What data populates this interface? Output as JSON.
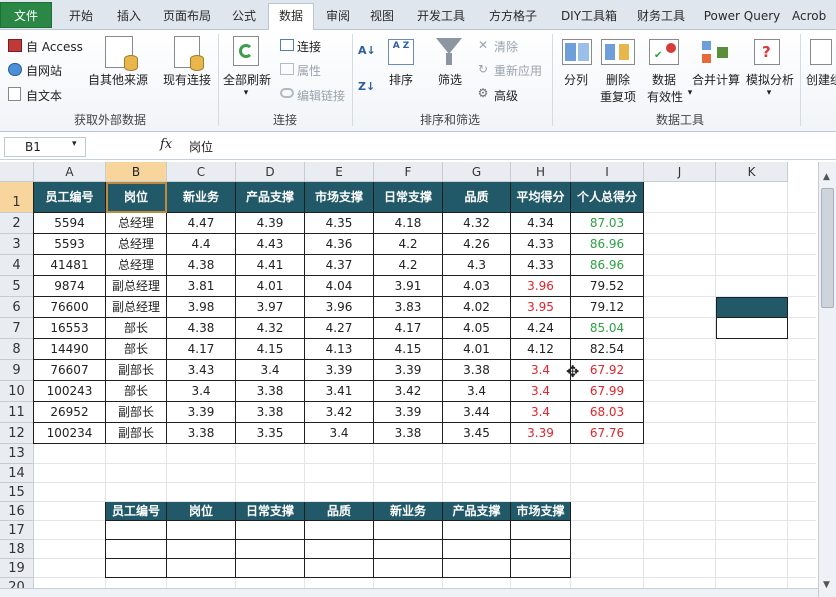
{
  "tabs": [
    "文件",
    "开始",
    "插入",
    "页面布局",
    "公式",
    "数据",
    "审阅",
    "视图",
    "开发工具",
    "方方格子",
    "DIY工具箱",
    "财务工具",
    "Power Query",
    "Acrob"
  ],
  "ribbon": {
    "get_external": {
      "access": "自 Access",
      "web": "自网站",
      "text": "自文本",
      "other": "自其他来源",
      "existing": "现有连接",
      "group": "获取外部数据"
    },
    "connections": {
      "refresh_all": "全部刷新",
      "connections": "连接",
      "properties": "属性",
      "edit_links": "编辑链接",
      "group": "连接"
    },
    "sort_filter": {
      "sort": "排序",
      "filter": "筛选",
      "clear": "清除",
      "reapply": "重新应用",
      "advanced": "高级",
      "group": "排序和筛选"
    },
    "data_tools": {
      "split": "分列",
      "remove_dup_1": "删除",
      "remove_dup_2": "重复项",
      "validation_1": "数据",
      "validation_2": "有效性",
      "consolidate": "合并计算",
      "whatif": "模拟分析",
      "group": "数据工具"
    },
    "outline": {
      "group_create": "创建组"
    }
  },
  "formula_bar": {
    "name_box": "B1",
    "fx": "fx",
    "value": "岗位"
  },
  "columns": [
    "A",
    "B",
    "C",
    "D",
    "E",
    "F",
    "G",
    "H",
    "I",
    "J",
    "K"
  ],
  "rows": [
    "1",
    "2",
    "3",
    "4",
    "5",
    "6",
    "7",
    "8",
    "9",
    "10",
    "11",
    "12",
    "13",
    "14",
    "15",
    "16",
    "17",
    "18",
    "19",
    "20"
  ],
  "table": {
    "headers": [
      "员工编号",
      "岗位",
      "新业务",
      "产品支撑",
      "市场支撑",
      "日常支撑",
      "品质",
      "平均得分",
      "个人总得分"
    ],
    "rows": [
      [
        "5594",
        "总经理",
        "4.47",
        "4.39",
        "4.35",
        "4.18",
        "4.32",
        "4.34",
        "87.03"
      ],
      [
        "5593",
        "总经理",
        "4.4",
        "4.43",
        "4.36",
        "4.2",
        "4.26",
        "4.33",
        "86.96"
      ],
      [
        "41481",
        "总经理",
        "4.38",
        "4.41",
        "4.37",
        "4.2",
        "4.3",
        "4.33",
        "86.96"
      ],
      [
        "9874",
        "副总经理",
        "3.81",
        "4.01",
        "4.04",
        "3.91",
        "4.03",
        "3.96",
        "79.52"
      ],
      [
        "76600",
        "副总经理",
        "3.98",
        "3.97",
        "3.96",
        "3.83",
        "4.02",
        "3.95",
        "79.12"
      ],
      [
        "16553",
        "部长",
        "4.38",
        "4.32",
        "4.27",
        "4.17",
        "4.05",
        "4.24",
        "85.04"
      ],
      [
        "14490",
        "部长",
        "4.17",
        "4.15",
        "4.13",
        "4.15",
        "4.01",
        "4.12",
        "82.54"
      ],
      [
        "76607",
        "副部长",
        "3.43",
        "3.4",
        "3.39",
        "3.39",
        "3.38",
        "3.4",
        "67.92"
      ],
      [
        "100243",
        "部长",
        "3.4",
        "3.38",
        "3.41",
        "3.42",
        "3.4",
        "3.4",
        "67.99"
      ],
      [
        "26952",
        "副部长",
        "3.39",
        "3.38",
        "3.42",
        "3.39",
        "3.44",
        "3.4",
        "68.03"
      ],
      [
        "100234",
        "副部长",
        "3.38",
        "3.35",
        "3.4",
        "3.38",
        "3.45",
        "3.39",
        "67.76"
      ]
    ],
    "avg_color": [
      "",
      "",
      "",
      "red",
      "red",
      "",
      "",
      "red",
      "red",
      "red",
      "red"
    ],
    "total_color": [
      "green",
      "green",
      "green",
      "",
      "",
      "green",
      "",
      "red",
      "red",
      "red",
      "red"
    ]
  },
  "table2": {
    "headers": [
      "员工编号",
      "岗位",
      "日常支撑",
      "品质",
      "新业务",
      "产品支撑",
      "市场支撑"
    ]
  },
  "colors": {
    "header_fill": "#215968",
    "red": "#e0242a",
    "green": "#2ea043",
    "file_tab": "#2a8745"
  }
}
